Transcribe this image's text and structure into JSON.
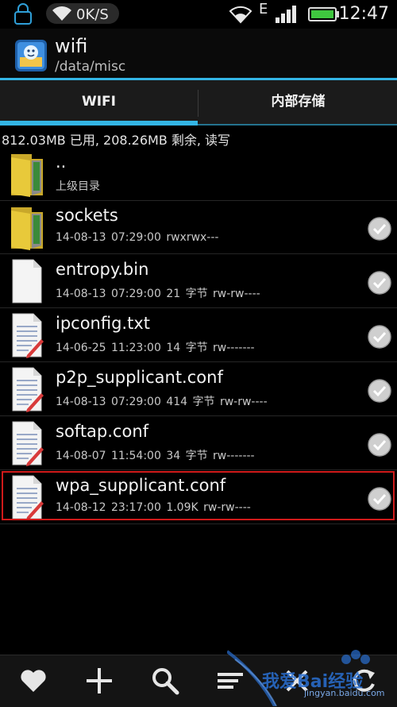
{
  "status_bar": {
    "speed": "0K/S",
    "network": "E",
    "time": "12:47"
  },
  "title_bar": {
    "title": "wifi",
    "path": "/data/misc"
  },
  "tabs": [
    {
      "label": "WIFI",
      "active": true
    },
    {
      "label": "内部存储",
      "active": false
    }
  ],
  "storage_info": "812.03MB 已用, 208.26MB 剩余, 读写",
  "files": [
    {
      "name": "..",
      "meta": "上级目录",
      "icon": "folder-icon",
      "checkbox": false
    },
    {
      "name": "sockets",
      "meta": "14-08-13 07:29:00  rwxrwx---",
      "icon": "folder-icon",
      "checkbox": true
    },
    {
      "name": "entropy.bin",
      "meta": "14-08-13 07:29:00  21 字节  rw-rw----",
      "icon": "blank-file-icon",
      "checkbox": true
    },
    {
      "name": "ipconfig.txt",
      "meta": "14-06-25 11:23:00  14 字节  rw-------",
      "icon": "text-file-icon",
      "checkbox": true
    },
    {
      "name": "p2p_supplicant.conf",
      "meta": "14-08-13 07:29:00  414 字节  rw-rw----",
      "icon": "text-file-icon",
      "checkbox": true
    },
    {
      "name": "softap.conf",
      "meta": "14-08-07 11:54:00  34 字节  rw-------",
      "icon": "text-file-icon",
      "checkbox": true
    },
    {
      "name": "wpa_supplicant.conf",
      "meta": "14-08-12 23:17:00  1.09K  rw-rw----",
      "icon": "text-file-icon",
      "checkbox": true,
      "highlighted": true
    }
  ],
  "bottom_bar": [
    "heart-icon",
    "plus-icon",
    "search-icon",
    "sort-icon",
    "close-icon",
    "refresh-icon"
  ],
  "watermark": {
    "text": "我爱Bai经验",
    "sub": "jingyan.baidu.com"
  },
  "colors": {
    "accent": "#33b5e5",
    "highlight": "#d01a1a",
    "background": "#000000"
  }
}
